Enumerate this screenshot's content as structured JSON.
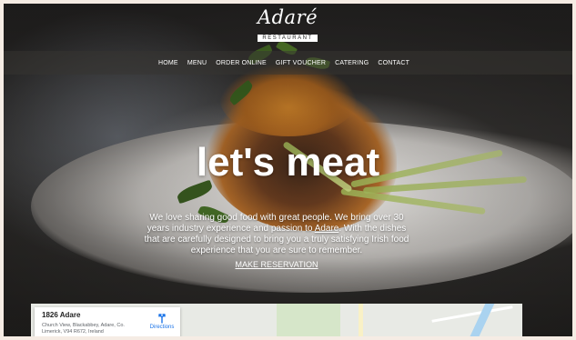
{
  "brand": {
    "name": "Adaré",
    "subtitle": "RESTAURANT"
  },
  "nav": {
    "items": [
      "HOME",
      "MENU",
      "ORDER ONLINE",
      "GIFT VOUCHER",
      "CATERING",
      "CONTACT"
    ]
  },
  "hero": {
    "headline": "let's meat",
    "intro_before": "We love sharing good food with great people. We bring over 30 years industry experience and passion to ",
    "intro_link": "Adare",
    "intro_after": ". With the dishes that are carefully designed to bring you a truly satisfying Irish food experience that you are sure to remember.",
    "cta": "MAKE RESERVATION"
  },
  "map": {
    "place_name": "1826 Adare",
    "address": "Church View, Blackabbey, Adare, Co. Limerick, V94 R672, Ireland",
    "directions_label": "Directions",
    "directions_icon": "directions-arrow-icon",
    "accent_color": "#1a73e8"
  }
}
